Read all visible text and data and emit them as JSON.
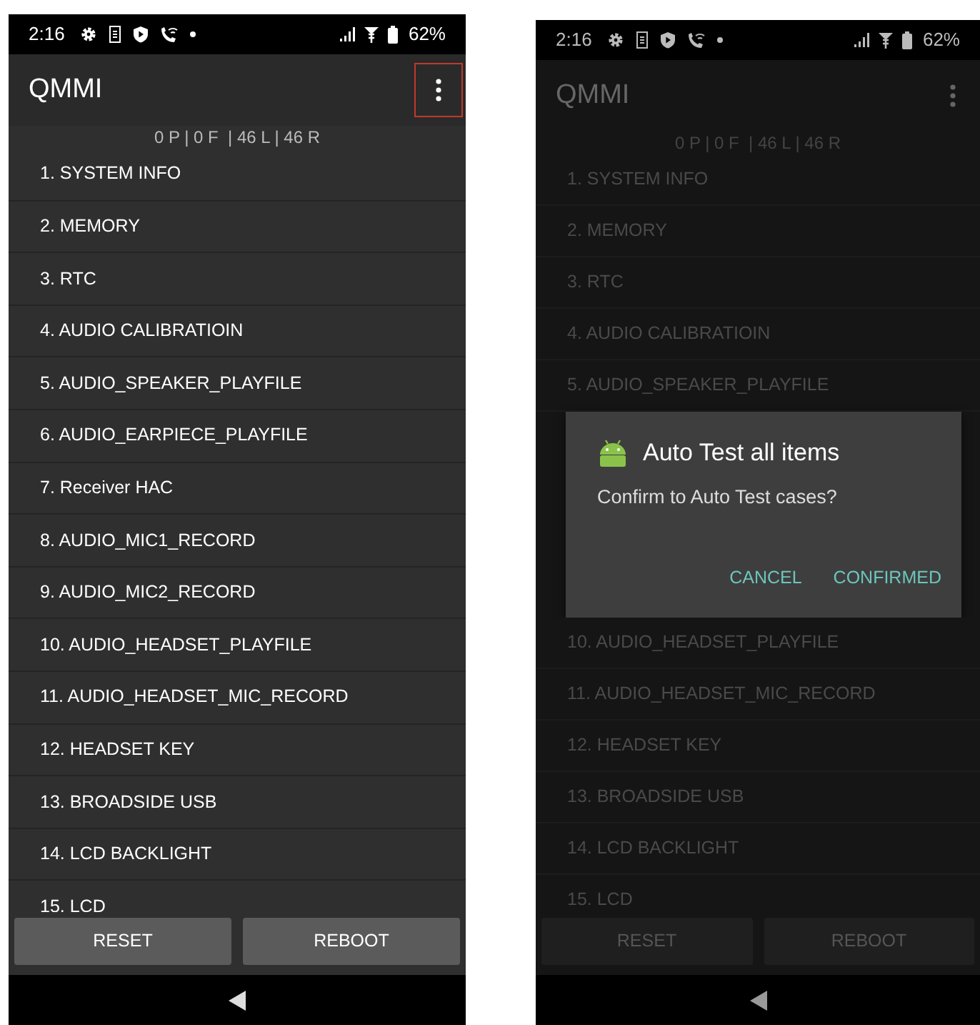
{
  "screens": [
    {
      "dimmed": false,
      "status_bar": {
        "time": "2:16",
        "battery": "62%"
      },
      "app_bar": {
        "title": "QMMI",
        "menu_highlighted": true
      },
      "summary": "0 P | 0 F  | 46 L | 46 R",
      "items_above": [
        "1. SYSTEM INFO",
        "2. MEMORY",
        "3. RTC",
        "4. AUDIO CALIBRATIOIN",
        "5. AUDIO_SPEAKER_PLAYFILE",
        "6. AUDIO_EARPIECE_PLAYFILE",
        "7. Receiver HAC",
        "8. AUDIO_MIC1_RECORD",
        "9. AUDIO_MIC2_RECORD",
        "10. AUDIO_HEADSET_PLAYFILE",
        "11. AUDIO_HEADSET_MIC_RECORD",
        "12. HEADSET KEY",
        "13. BROADSIDE USB",
        "14. LCD BACKLIGHT",
        "15. LCD"
      ],
      "buttons": [
        "RESET",
        "REBOOT"
      ]
    },
    {
      "dimmed": true,
      "status_bar": {
        "time": "2:16",
        "battery": "62%"
      },
      "app_bar": {
        "title": "QMMI",
        "menu_highlighted": false
      },
      "summary": "0 P | 0 F  | 46 L | 46 R",
      "items_above": [
        "1. SYSTEM INFO",
        "2. MEMORY",
        "3. RTC",
        "4. AUDIO CALIBRATIOIN",
        "5. AUDIO_SPEAKER_PLAYFILE"
      ],
      "dialog": {
        "title": "Auto Test all items",
        "message": "Confirm to Auto Test cases?",
        "buttons": [
          "CANCEL",
          "CONFIRMED"
        ]
      },
      "items_below": [
        "10. AUDIO_HEADSET_PLAYFILE",
        "11. AUDIO_HEADSET_MIC_RECORD",
        "12. HEADSET KEY",
        "13. BROADSIDE USB",
        "14. LCD BACKLIGHT",
        "15. LCD"
      ],
      "buttons": [
        "RESET",
        "REBOOT"
      ]
    }
  ]
}
